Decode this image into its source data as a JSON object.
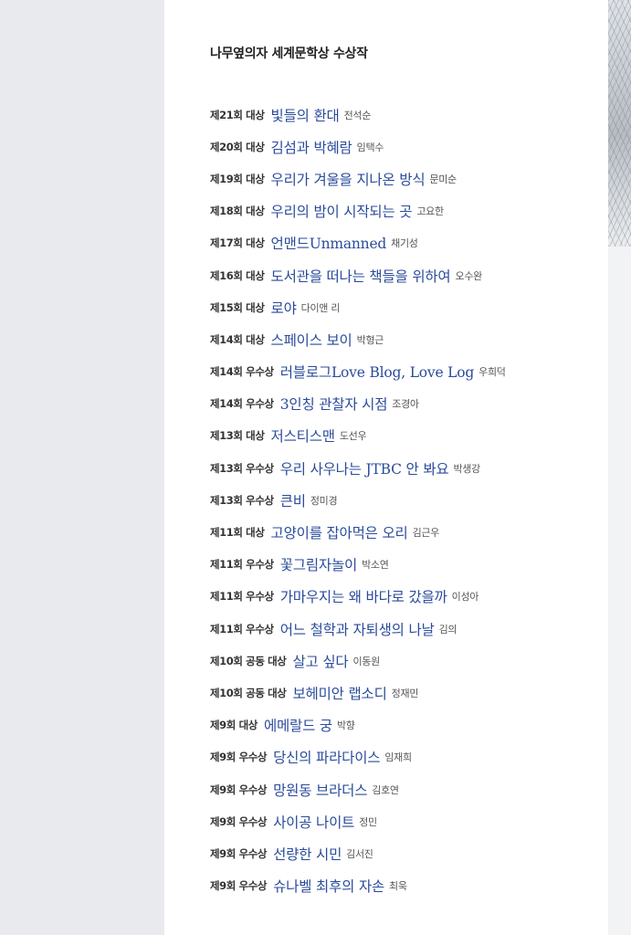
{
  "page": {
    "title": "나무옆의자 세계문학상 수상작"
  },
  "awards": [
    {
      "edition": "제21회 대상",
      "book": "빛들의 환대",
      "author": "전석순"
    },
    {
      "edition": "제20회 대상",
      "book": "김섬과 박혜람",
      "author": "임택수"
    },
    {
      "edition": "제19회 대상",
      "book": "우리가 겨울을 지나온 방식",
      "author": "문미순"
    },
    {
      "edition": "제18회 대상",
      "book": "우리의 밤이 시작되는 곳",
      "author": "고요한"
    },
    {
      "edition": "제17회 대상",
      "book": "언맨드Unmanned",
      "author": "채기성"
    },
    {
      "edition": "제16회 대상",
      "book": "도서관을 떠나는 책들을 위하여",
      "author": "오수완"
    },
    {
      "edition": "제15회 대상",
      "book": "로야",
      "author": "다이앤 리"
    },
    {
      "edition": "제14회 대상",
      "book": "스페이스 보이",
      "author": "박형근"
    },
    {
      "edition": "제14회 우수상",
      "book": "러블로그Love Blog, Love Log",
      "author": "우희덕"
    },
    {
      "edition": "제14회 우수상",
      "book": "3인칭 관찰자 시점",
      "author": "조경아"
    },
    {
      "edition": "제13회 대상",
      "book": "저스티스맨",
      "author": "도선우"
    },
    {
      "edition": "제13회 우수상",
      "book": "우리 사우나는 JTBC 안 봐요",
      "author": "박생강"
    },
    {
      "edition": "제13회 우수상",
      "book": "큰비",
      "author": "정미경"
    },
    {
      "edition": "제11회 대상",
      "book": "고양이를 잡아먹은 오리",
      "author": "김근우"
    },
    {
      "edition": "제11회 우수상",
      "book": "꽃그림자놀이",
      "author": "박소연"
    },
    {
      "edition": "제11회 우수상",
      "book": "가마우지는 왜 바다로 갔을까",
      "author": "이성아"
    },
    {
      "edition": "제11회 우수상",
      "book": "어느 철학과 자퇴생의 나날",
      "author": "김의"
    },
    {
      "edition": "제10회 공동 대상",
      "book": "살고 싶다",
      "author": "이동원"
    },
    {
      "edition": "제10회 공동 대상",
      "book": "보헤미안 랩소디",
      "author": "정재민"
    },
    {
      "edition": "제9회 대상",
      "book": "에메랄드 궁",
      "author": "박향"
    },
    {
      "edition": "제9회 우수상",
      "book": "당신의 파라다이스",
      "author": "임재희"
    },
    {
      "edition": "제9회 우수상",
      "book": "망원동 브라더스",
      "author": "김호연"
    },
    {
      "edition": "제9회 우수상",
      "book": "사이공 나이트",
      "author": "정민"
    },
    {
      "edition": "제9회 우수상",
      "book": "선량한 시민",
      "author": "김서진"
    },
    {
      "edition": "제9회 우수상",
      "book": "슈나벨 최후의 자손",
      "author": "최욱"
    }
  ]
}
